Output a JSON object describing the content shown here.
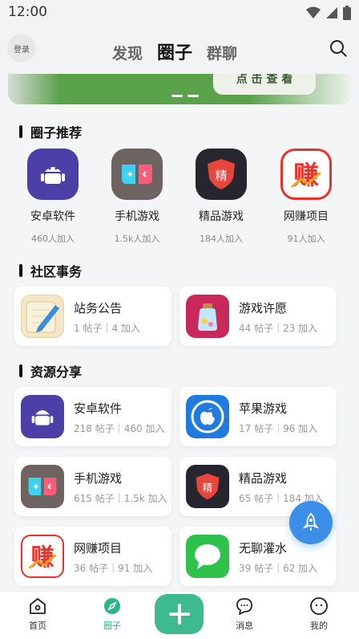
{
  "status": {
    "time": "12:00"
  },
  "header": {
    "login_label": "登录",
    "tabs": [
      "发现",
      "圈子",
      "群聊"
    ]
  },
  "banner": {
    "text": "点 击 查 看"
  },
  "recommend": {
    "title": "圈子推荐",
    "items": [
      {
        "name": "安卓软件",
        "count": "460人加入"
      },
      {
        "name": "手机游戏",
        "count": "1.5k人加入"
      },
      {
        "name": "精品游戏",
        "count": "184人加入"
      },
      {
        "name": "网赚项目",
        "count": "91人加入"
      }
    ]
  },
  "community": {
    "title": "社区事务",
    "cards": [
      {
        "name": "站务公告",
        "stats": "1 帖子｜4 加入"
      },
      {
        "name": "游戏许愿",
        "stats": "44 帖子｜23 加入"
      }
    ]
  },
  "resources": {
    "title": "资源分享",
    "cards": [
      {
        "name": "安卓软件",
        "stats": "218 帖子｜460 加入"
      },
      {
        "name": "苹果游戏",
        "stats": "17 帖子｜96 加入"
      },
      {
        "name": "手机游戏",
        "stats": "615 帖子｜1.5k 加入"
      },
      {
        "name": "精品游戏",
        "stats": "65 帖子｜184 加入"
      },
      {
        "name": "网赚项目",
        "stats": "36 帖子｜91 加入"
      },
      {
        "name": "无聊灌水",
        "stats": "39 帖子｜62 加入"
      }
    ]
  },
  "icon_glyphs": {
    "jing": "精",
    "zhuan": "赚"
  },
  "bottom_nav": [
    "首页",
    "圈子",
    "消息",
    "我的"
  ],
  "colors": {
    "accent": "#3dbb8e",
    "fab": "#3b8fe8"
  }
}
